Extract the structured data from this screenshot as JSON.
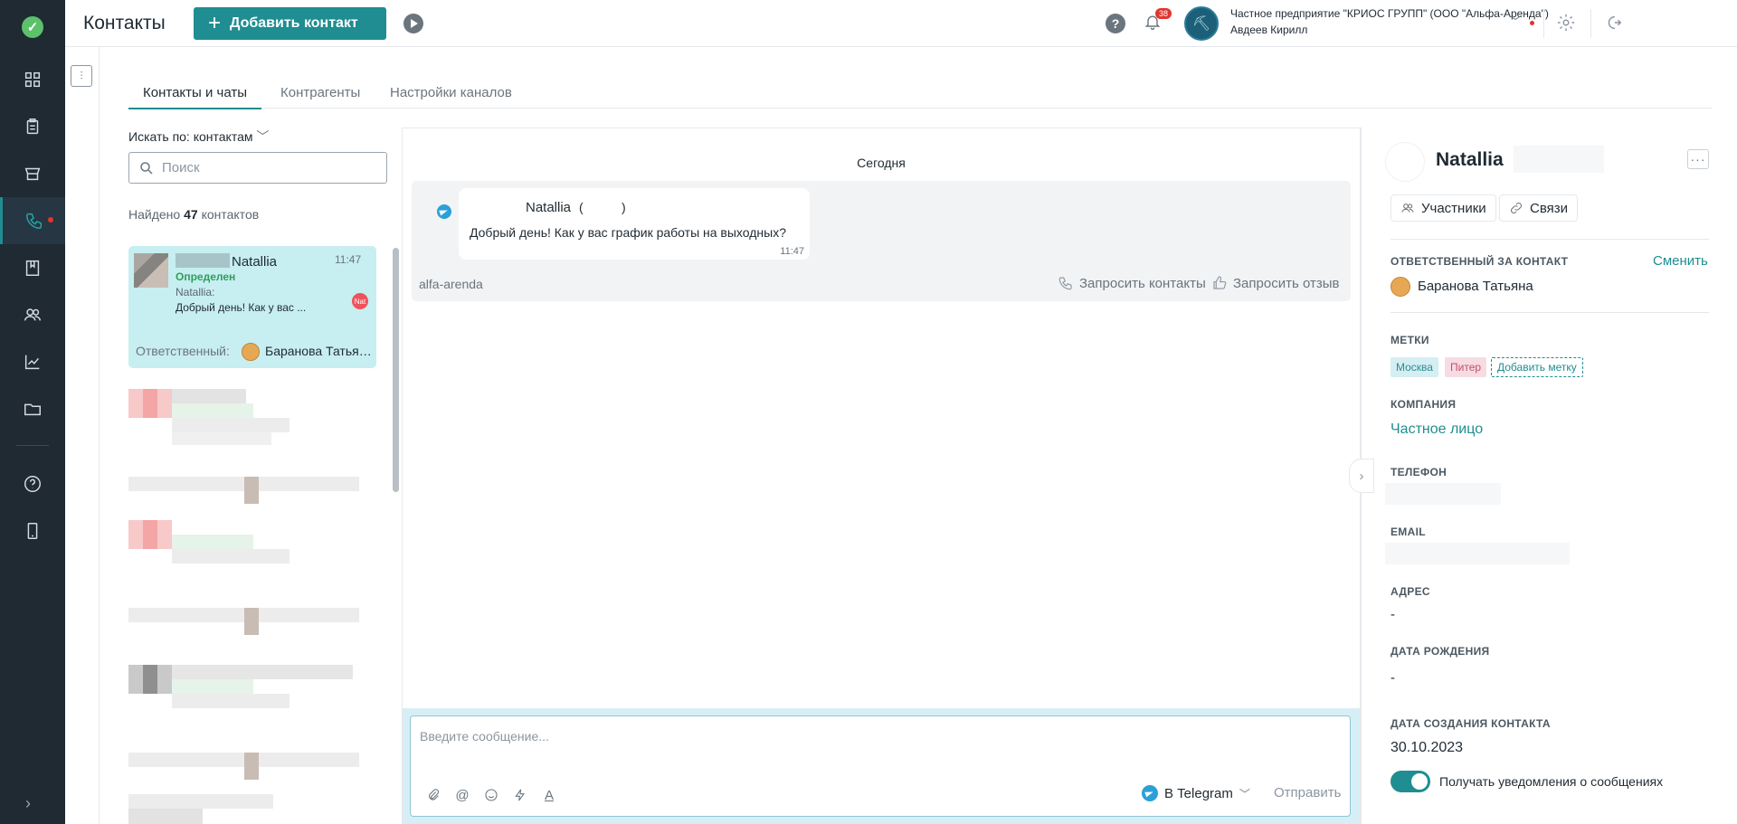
{
  "header": {
    "title": "Контакты",
    "add_button": "Добавить контакт",
    "notifications_count": "38",
    "org_name": "Частное предприятие \"КРИОС ГРУПП\" (ООО \"Альфа-Аренда\")",
    "user_name": "Авдеев Кирилл"
  },
  "tabs": [
    "Контакты и чаты",
    "Контрагенты",
    "Настройки каналов"
  ],
  "contacts": {
    "search_by": "Искать по: контактам",
    "search_placeholder": "Поиск",
    "found_prefix": "Найдено",
    "found_count": "47",
    "found_suffix": "контактов",
    "selected": {
      "name": "Natallia",
      "time": "11:47",
      "status": "Определен",
      "sender": "Natallia:",
      "preview": "Добрый день! Как у вас ...",
      "badge": "Nat",
      "responsible_label": "Ответственный:",
      "responsible_name": "Баранова Татьяна"
    }
  },
  "chat": {
    "date_separator": "Сегодня",
    "message": {
      "author": "Natallia",
      "paren_open": "(",
      "paren_close": ")",
      "text": "Добрый день! Как у вас график работы на выходных?",
      "time": "11:47",
      "source": "alfa-arenda"
    },
    "actions": {
      "request_contacts": "Запросить контакты",
      "request_review": "Запросить отзыв"
    },
    "composer": {
      "placeholder": "Введите сообщение...",
      "channel": "В Telegram",
      "send": "Отправить"
    }
  },
  "details": {
    "name": "Natallia",
    "participants": "Участники",
    "links": "Связи",
    "responsible_label": "ОТВЕТСТВЕННЫЙ ЗА КОНТАКТ",
    "change": "Сменить",
    "responsible_name": "Баранова Татьяна",
    "tags_label": "МЕТКИ",
    "tags": [
      "Москва",
      "Питер"
    ],
    "add_tag": "Добавить метку",
    "company_label": "КОМПАНИЯ",
    "company": "Частное лицо",
    "phone_label": "ТЕЛЕФОН",
    "email_label": "EMAIL",
    "address_label": "АДРЕС",
    "address": "-",
    "birthday_label": "ДАТА РОЖДЕНИЯ",
    "birthday": "-",
    "created_label": "ДАТА СОЗДАНИЯ КОНТАКТА",
    "created": "30.10.2023",
    "notify_label": "Получать уведомления о сообщениях",
    "notify_on": true
  },
  "colors": {
    "accent": "#1f8d91",
    "rail": "#1f2a33",
    "selected_card": "#c7eef1",
    "alert": "#e2342d"
  }
}
